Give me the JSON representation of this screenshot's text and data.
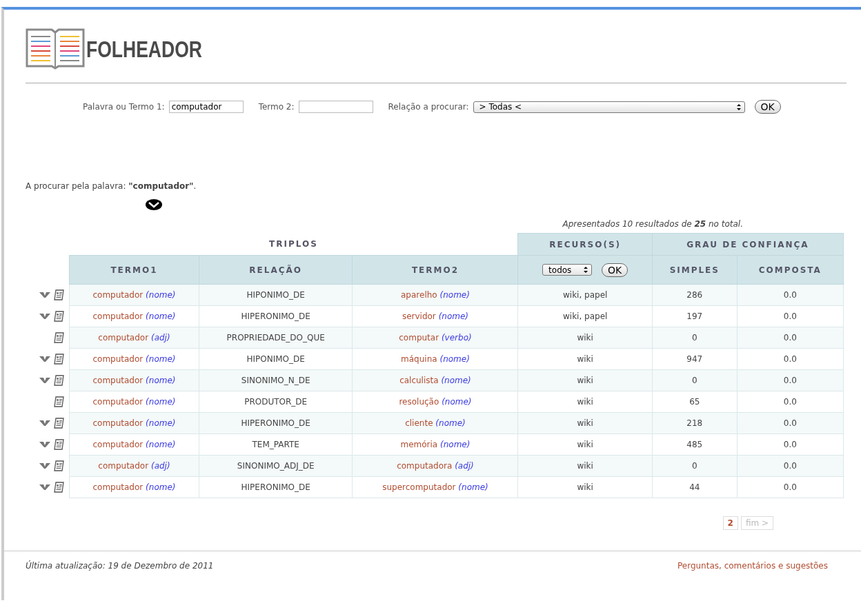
{
  "logo": {
    "title": "FOLHEADOR"
  },
  "search_form": {
    "fields": [
      {
        "label": "Palavra ou Termo 1:",
        "value": "computador"
      },
      {
        "label": "Termo 2:"
      }
    ],
    "relation": {
      "label": "Relação a procurar:",
      "value": "> Todas <"
    },
    "button": "OK"
  },
  "search_info": {
    "text": "A procurar pela palavra: **\"computador\"**."
  },
  "summary": "Apresentados 10 resultados de **25** no total.",
  "table": {
    "groups": [
      "TRIPLOS",
      "RECURSO(S)",
      "GRAU DE CONFIANÇA"
    ],
    "columns": [
      "TERMO1",
      "RELAÇÃO",
      "TERMO2",
      "SIMPLES",
      "COMPOSTA"
    ],
    "source_filter": {
      "value": "todos",
      "button": "OK"
    },
    "rows": [
      {
        "expandable": true,
        "term1": {
          "word": "computador",
          "pos": "(nome)"
        },
        "relation": "HIPONIMO_DE",
        "term2": {
          "word": "aparelho",
          "pos": "(nome)"
        },
        "sources": "wiki, papel",
        "simple": "286",
        "compound": "0.0"
      },
      {
        "expandable": true,
        "term1": {
          "word": "computador",
          "pos": "(nome)"
        },
        "relation": "HIPERONIMO_DE",
        "term2": {
          "word": "servidor",
          "pos": "(nome)"
        },
        "sources": "wiki, papel",
        "simple": "197",
        "compound": "0.0"
      },
      {
        "expandable": false,
        "term1": {
          "word": "computador",
          "pos": "(adj)"
        },
        "relation": "PROPRIEDADE_DO_QUE",
        "term2": {
          "word": "computar",
          "pos": "(verbo)"
        },
        "sources": "wiki",
        "simple": "0",
        "compound": "0.0"
      },
      {
        "expandable": true,
        "term1": {
          "word": "computador",
          "pos": "(nome)"
        },
        "relation": "HIPONIMO_DE",
        "term2": {
          "word": "máquina",
          "pos": "(nome)"
        },
        "sources": "wiki",
        "simple": "947",
        "compound": "0.0"
      },
      {
        "expandable": true,
        "term1": {
          "word": "computador",
          "pos": "(nome)"
        },
        "relation": "SINONIMO_N_DE",
        "term2": {
          "word": "calculista",
          "pos": "(nome)"
        },
        "sources": "wiki",
        "simple": "0",
        "compound": "0.0"
      },
      {
        "expandable": false,
        "term1": {
          "word": "computador",
          "pos": "(nome)"
        },
        "relation": "PRODUTOR_DE",
        "term2": {
          "word": "resolução",
          "pos": "(nome)"
        },
        "sources": "wiki",
        "simple": "65",
        "compound": "0.0"
      },
      {
        "expandable": true,
        "term1": {
          "word": "computador",
          "pos": "(nome)"
        },
        "relation": "HIPERONIMO_DE",
        "term2": {
          "word": "cliente",
          "pos": "(nome)"
        },
        "sources": "wiki",
        "simple": "218",
        "compound": "0.0"
      },
      {
        "expandable": true,
        "term1": {
          "word": "computador",
          "pos": "(nome)"
        },
        "relation": "TEM_PARTE",
        "term2": {
          "word": "memória",
          "pos": "(nome)"
        },
        "sources": "wiki",
        "simple": "485",
        "compound": "0.0"
      },
      {
        "expandable": true,
        "term1": {
          "word": "computador",
          "pos": "(adj)"
        },
        "relation": "SINONIMO_ADJ_DE",
        "term2": {
          "word": "computadora",
          "pos": "(adj)"
        },
        "sources": "wiki",
        "simple": "0",
        "compound": "0.0"
      },
      {
        "expandable": true,
        "term1": {
          "word": "computador",
          "pos": "(nome)"
        },
        "relation": "HIPERONIMO_DE",
        "term2": {
          "word": "supercomputador",
          "pos": "(nome)"
        },
        "sources": "wiki",
        "simple": "44",
        "compound": "0.0"
      }
    ]
  },
  "pagination": [
    {
      "label": "2",
      "disabled": false
    },
    {
      "label": "fim >",
      "disabled": true
    }
  ],
  "footer": {
    "updated": "Última atualização: 19 de Dezembro de 2011",
    "link": "Perguntas, comentários e sugestões"
  }
}
